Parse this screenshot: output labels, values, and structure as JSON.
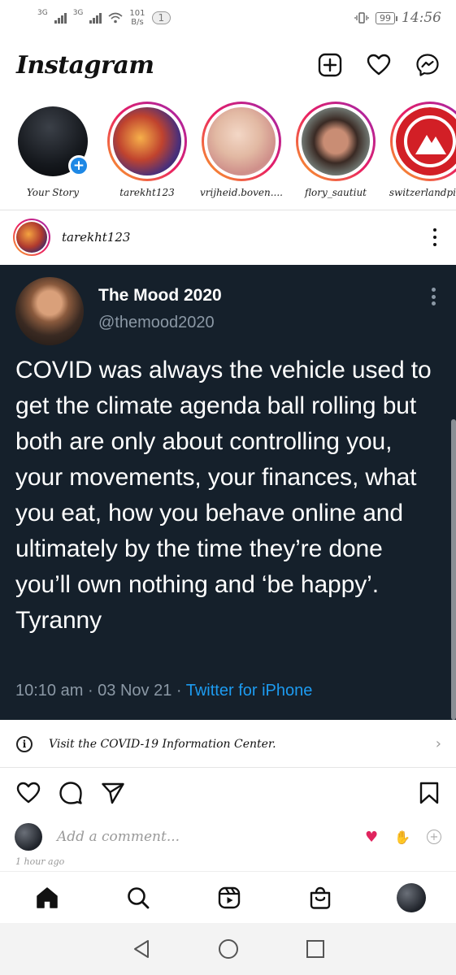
{
  "status_bar": {
    "network1": "3G",
    "network2": "3G",
    "speed_value": "101",
    "speed_unit": "B/s",
    "notification_count": "1",
    "battery": "99",
    "time": "14:56"
  },
  "header": {
    "logo": "Instagram",
    "icons": [
      "new-post-icon",
      "heart-icon",
      "messenger-icon"
    ]
  },
  "stories": [
    {
      "name": "Your Story",
      "own": true
    },
    {
      "name": "tarekht123"
    },
    {
      "name": "vrijheid.boven...."
    },
    {
      "name": "flory_sautiut"
    },
    {
      "name": "switzerlandpic..."
    }
  ],
  "post": {
    "username": "tarekht123",
    "tweet": {
      "display_name": "The Mood 2020",
      "handle": "@themood2020",
      "text": "COVID was always the vehicle used to get the climate agenda ball rolling but both are only about controlling you, your movements, your finances, what you eat, how you behave online and ultimately by the time they’re done you’ll own nothing and ‘be happy’. Tyranny",
      "timestamp": "10:10 am · 03 Nov 21 · ",
      "source": "Twitter for iPhone"
    },
    "info_banner": "Visit the COVID-19 Information Center.",
    "comment_placeholder": "Add a comment...",
    "time_ago": "1 hour ago"
  },
  "colors": {
    "tweet_bg": "#15202b",
    "tweet_link": "#1d9bf0",
    "story_ring": "#e91e63",
    "badge_blue": "#1e88e5"
  }
}
